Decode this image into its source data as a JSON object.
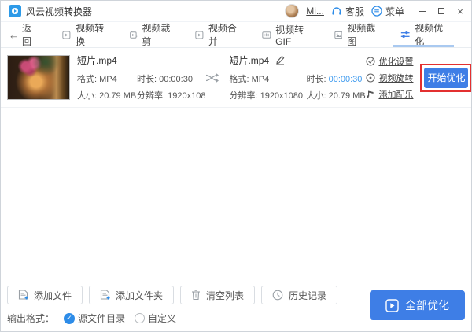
{
  "app": {
    "title": "风云视频转换器",
    "accent_color": "#3e7ee6",
    "annotation_color": "#e33030",
    "link_color": "#3f9bef"
  },
  "titlebar": {
    "user": "Mi...",
    "service_label": "客服",
    "menu_label": "菜单"
  },
  "icons": {
    "back_arrow": "←",
    "close": "×",
    "music_note": "♪",
    "check": "✓"
  },
  "nav": {
    "back_label": "返回",
    "tabs": [
      {
        "label": "视频转换",
        "active": false
      },
      {
        "label": "视频裁剪",
        "active": false
      },
      {
        "label": "视频合并",
        "active": false
      },
      {
        "label": "视频转GIF",
        "active": false
      },
      {
        "label": "视频截图",
        "active": false
      },
      {
        "label": "视频优化",
        "active": true
      }
    ]
  },
  "file_row": {
    "source": {
      "name": "短片.mp4",
      "format_label": "格式:",
      "format": "MP4",
      "duration_label": "时长:",
      "duration": "00:00:30",
      "size_label": "大小:",
      "size": "20.79 MB",
      "resolution_label": "分辨率:",
      "resolution": "1920x108"
    },
    "output": {
      "name": "短片.mp4",
      "format_label": "格式:",
      "format": "MP4",
      "duration_label": "时长:",
      "duration": "00:00:30",
      "resolution_label": "分辨率:",
      "resolution": "1920x1080",
      "size_label": "大小:",
      "size": "20.79 MB"
    },
    "options": [
      {
        "label": "优化设置"
      },
      {
        "label": "视频旋转"
      },
      {
        "label": "添加配乐"
      }
    ],
    "start_button": "开始优化"
  },
  "toolbar": {
    "add_file": "添加文件",
    "add_folder": "添加文件夹",
    "clear_list": "清空列表",
    "history": "历史记录",
    "optimize_all": "全部优化"
  },
  "output_format": {
    "label": "输出格式：",
    "options": [
      {
        "label": "源文件目录",
        "selected": true
      },
      {
        "label": "自定义",
        "selected": false
      }
    ]
  }
}
